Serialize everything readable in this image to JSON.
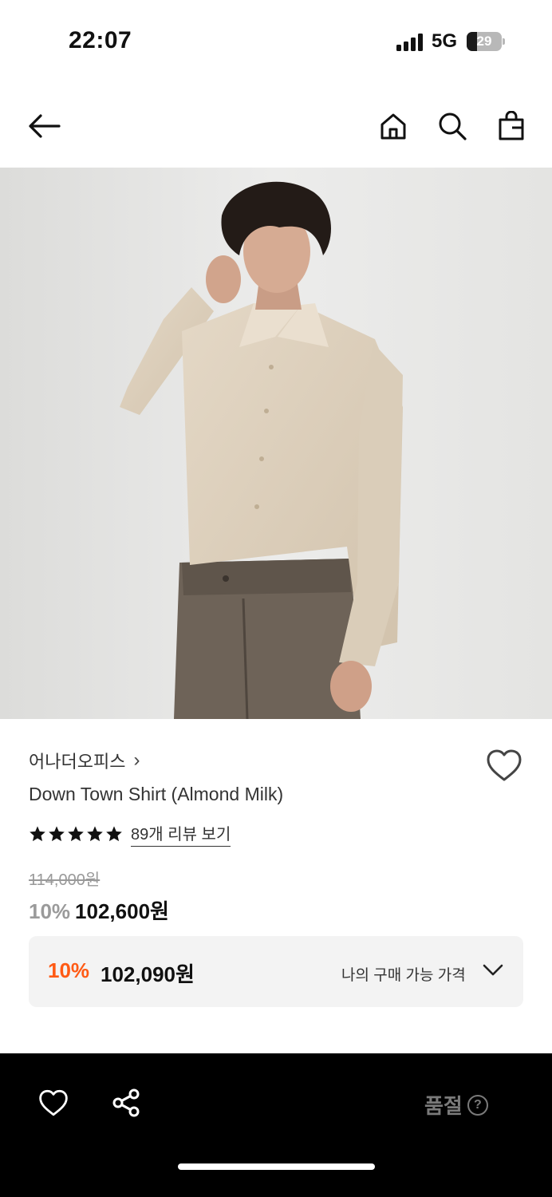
{
  "status_bar": {
    "time": "22:07",
    "network": "5G",
    "battery_percent": "29",
    "battery_level": 0.29
  },
  "nav": {
    "back_icon": "arrow-left-icon",
    "home_icon": "home-icon",
    "search_icon": "search-icon",
    "cart_icon": "shopping-bag-icon"
  },
  "product": {
    "brand": "어나더오피스",
    "brand_chevron": "›",
    "name": "Down Town Shirt (Almond Milk)",
    "rating_stars": 5,
    "review_link": "89개 리뷰 보기",
    "original_price": "114,000원",
    "discount_rate": "10%",
    "sale_price": "102,600원",
    "my_price": {
      "discount_rate": "10%",
      "price": "102,090원",
      "label": "나의 구매 가능 가격"
    }
  },
  "bottom_bar": {
    "status": "품절",
    "help_glyph": "?"
  },
  "colors": {
    "accent": "#ff5a14",
    "bottom_bar_bg": "#000000",
    "price_box_bg": "#f3f3f3"
  }
}
